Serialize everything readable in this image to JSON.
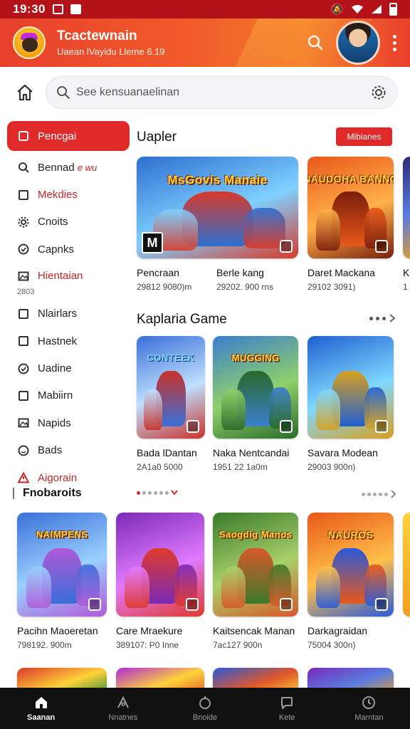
{
  "status_bar": {
    "time": "19:30"
  },
  "header": {
    "app_title": "Tcactewnain",
    "app_subtitle": "Uaean lVayidu Lleme 6.19"
  },
  "search": {
    "placeholder": "See kensuanaelinan"
  },
  "sidebar": {
    "items": [
      {
        "label": "Pencgai",
        "icon": "square-icon",
        "active": true
      },
      {
        "label": "Bennad",
        "icon": "search-icon",
        "badge": "e wu"
      },
      {
        "label": "Mekdies",
        "icon": "square-icon",
        "red": true
      },
      {
        "label": "Cnoits",
        "icon": "gear-icon"
      },
      {
        "label": "Capnks",
        "icon": "circle-check-icon"
      },
      {
        "label": "Hientaian",
        "icon": "image-icon",
        "sub": "2803",
        "red": true
      },
      {
        "label": "Nlairlars",
        "icon": "square-icon"
      },
      {
        "label": "Hastnek",
        "icon": "square-icon"
      },
      {
        "label": "Uadine",
        "icon": "circle-check-icon"
      },
      {
        "label": "Mabiirn",
        "icon": "square-icon"
      },
      {
        "label": "Napids",
        "icon": "image-icon"
      },
      {
        "label": "Bads",
        "icon": "smile-icon"
      },
      {
        "label": "Aigorain",
        "icon": "warning-icon",
        "red": true
      }
    ],
    "footer": "Fnobaroits"
  },
  "sections": {
    "first": {
      "title": "Uapler",
      "button": "Mibianes"
    },
    "second": {
      "title": "Kaplaria Game"
    }
  },
  "row1": [
    {
      "name": "Pencraan",
      "meta": "29812 9080)m",
      "art": "MsGovis Manaie",
      "palette": [
        "#2d6fd0",
        "#7fd0ff",
        "#d83a2a"
      ]
    },
    {
      "name": "Berle kang",
      "meta": "29202. 900 rns",
      "art": "",
      "palette": [
        "#2d6fd0",
        "#7fd0ff",
        "#2a8a3a"
      ]
    },
    {
      "name": "Daret Mackana",
      "meta": "29102 3091)",
      "art": "NAUDOHA BANNG",
      "palette": [
        "#e8581a",
        "#ffb14a",
        "#7a1e0c"
      ]
    },
    {
      "name": "K",
      "meta": "1",
      "art": "",
      "palette": [
        "#2b2f6e",
        "#5a7be0",
        "#e0a030"
      ]
    }
  ],
  "row2": [
    {
      "name": "Bada lDantan",
      "meta": "2A1a0 5000",
      "art": "CONTEEK",
      "palette": [
        "#3a6fd8",
        "#bfe0ff",
        "#c8322a"
      ]
    },
    {
      "name": "Naka Nentcandai",
      "meta": "1951 22 1a0m",
      "art": "MUGGING",
      "palette": [
        "#3a7fd0",
        "#8fd06a",
        "#2a6a2a"
      ]
    },
    {
      "name": "Savara Modean",
      "meta": "29003 900n)",
      "art": "",
      "palette": [
        "#1f5fd0",
        "#7fd8ff",
        "#d8a020"
      ]
    }
  ],
  "row3": [
    {
      "name": "Pacihn Maoeretan",
      "meta": "798192. 900m",
      "art": "NAIMPENS",
      "palette": [
        "#3a6fd8",
        "#9ad0ff",
        "#b05ad8"
      ]
    },
    {
      "name": "Care Mraekure",
      "meta": "389107: P0 Inne",
      "art": "",
      "palette": [
        "#7a2ab8",
        "#e07aff",
        "#e03a2a"
      ]
    },
    {
      "name": "Kaitsencak Manan",
      "meta": "7ac127 900n",
      "art": "Saogdig Manos",
      "palette": [
        "#3a7a2a",
        "#a8d06a",
        "#d8582a"
      ]
    },
    {
      "name": "Darkagraidan",
      "meta": "75004 300n)",
      "art": "NAUROS",
      "palette": [
        "#e8581a",
        "#ffc04a",
        "#2a5ad8"
      ]
    }
  ],
  "row4": [
    {
      "palette": [
        "#d83a2a",
        "#ffd23a",
        "#2a8a3a"
      ]
    },
    {
      "palette": [
        "#b02ad8",
        "#ffd23a",
        "#e0582a"
      ]
    },
    {
      "palette": [
        "#2a5ad8",
        "#e0582a",
        "#ffd23a"
      ]
    },
    {
      "palette": [
        "#7a2ab8",
        "#5a7be0",
        "#e0a030"
      ]
    }
  ],
  "bottom_nav": [
    {
      "label": "Saanan",
      "icon": "home-icon",
      "active": true
    },
    {
      "label": "Nnatnes",
      "icon": "tag-icon"
    },
    {
      "label": "Bnoide",
      "icon": "circle-icon"
    },
    {
      "label": "Kete",
      "icon": "chat-icon"
    },
    {
      "label": "Marntan",
      "icon": "clock-icon"
    }
  ]
}
